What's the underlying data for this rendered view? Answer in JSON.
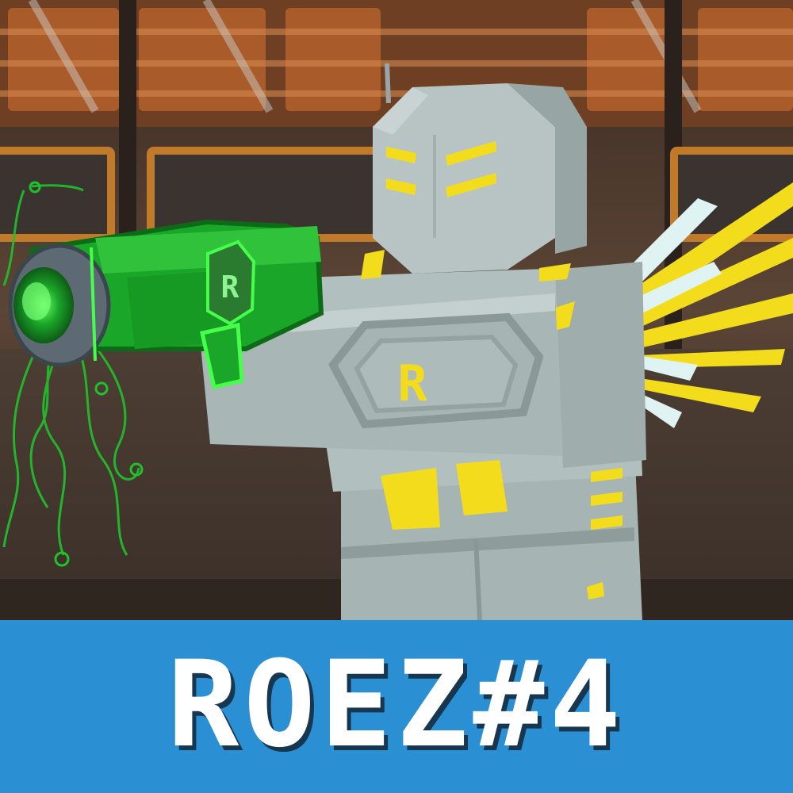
{
  "banner": {
    "title": "ROEZ#4"
  },
  "scene": {
    "character_emblem": "R",
    "weapon_emblem": "R"
  },
  "colors": {
    "banner_background": "#2b8fd4",
    "banner_text": "#ffffff",
    "armor_gray": "#a6b4b4",
    "accent_yellow": "#f3dc1c",
    "weapon_green": "#1aa628",
    "background_orange": "#b4602c"
  },
  "icons": {
    "character": "robot-knight-icon",
    "weapon": "blaster-icon",
    "wings": "wings-icon"
  }
}
